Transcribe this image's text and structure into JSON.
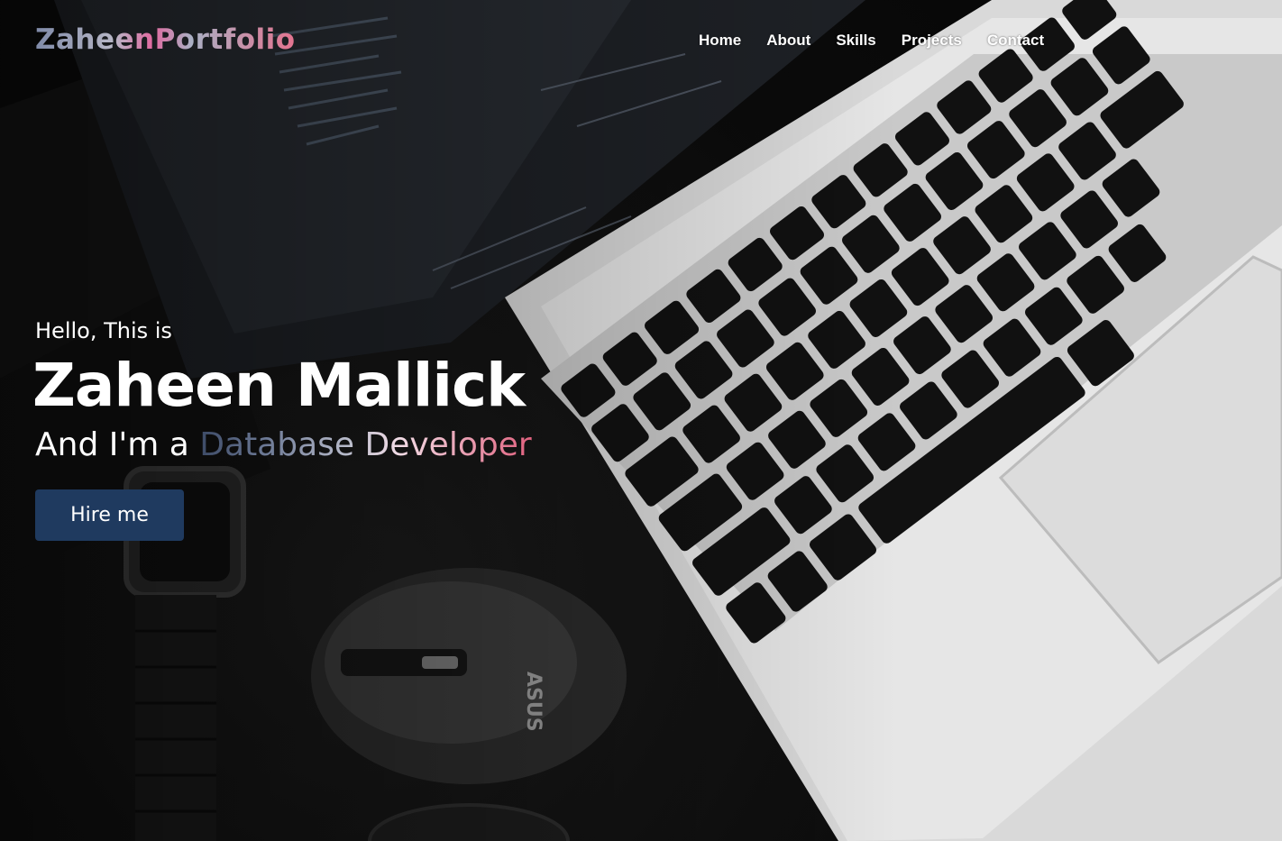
{
  "nav": {
    "logo": "ZaheenPortfolio",
    "links": [
      "Home",
      "About",
      "Skills",
      "Projects",
      "Contact"
    ]
  },
  "hero": {
    "greeting": "Hello, This is",
    "name": "Zaheen Mallick",
    "role_prefix": "And I'm a ",
    "role_highlight": "Database Developer",
    "cta_label": "Hire me"
  },
  "colors": {
    "button_bg": "#1f3a5f",
    "accent_pink": "#e0617e",
    "accent_slate": "#6d7a96"
  }
}
